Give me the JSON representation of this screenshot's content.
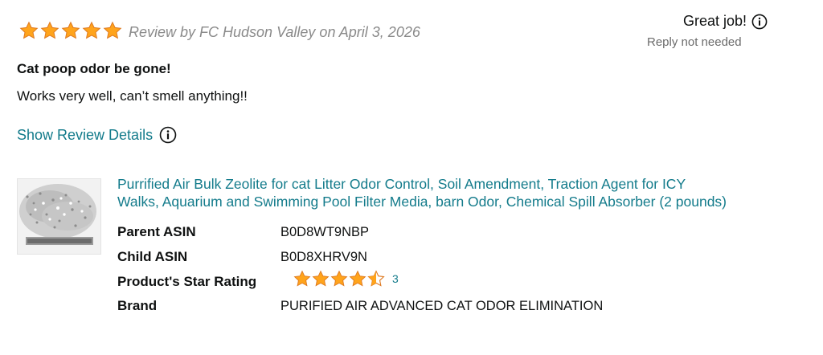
{
  "review": {
    "star_count": 5,
    "meta": "Review by FC Hudson Valley on April 3, 2026",
    "title": "Cat poop odor be gone!",
    "body": "Works very well, can’t smell anything!!",
    "show_details_label": "Show Review Details"
  },
  "response": {
    "status": "Great job!",
    "note": "Reply not needed"
  },
  "product": {
    "title_line1": "Purrified Air Bulk Zeolite for cat Litter Odor Control, Soil Amendment, Traction Agent for ICY",
    "title_line2": "Walks, Aquarium and Swimming Pool Filter Media, barn Odor, Chemical Spill Absorber (2 pounds)",
    "details": {
      "parent_asin_label": "Parent ASIN",
      "parent_asin": "B0D8WT9NBP",
      "child_asin_label": "Child ASIN",
      "child_asin": "B0D8XHRV9N",
      "star_rating_label": "Product's Star Rating",
      "star_rating": 4.5,
      "rating_count": "3",
      "brand_label": "Brand",
      "brand": "PURIFIED AIR ADVANCED CAT ODOR ELIMINATION"
    }
  },
  "icons": {
    "star": "star-icon",
    "info": "info-icon"
  },
  "colors": {
    "star_fill": "#ffa41c",
    "star_stroke": "#de7921",
    "link": "#137b8b",
    "meta_text": "#8a8a8a"
  }
}
